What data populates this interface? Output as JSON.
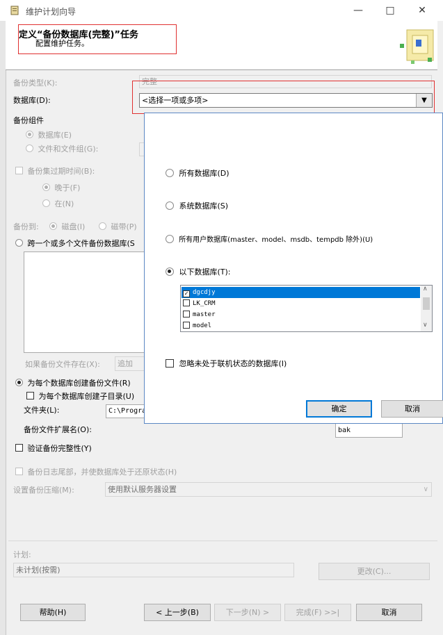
{
  "window": {
    "title": "维护计划向导"
  },
  "header": {
    "title": "定义“备份数据库(完整)”任务",
    "subtitle": "配置维护任务。"
  },
  "form": {
    "backup_type_label": "备份类型(K):",
    "backup_type_value": "完整",
    "database_label": "数据库(D):",
    "database_value": "<选择一项或多项>",
    "backup_component_label": "备份组件",
    "radio_database": "数据库(E)",
    "radio_files": "文件和文件组(G):",
    "expire_label": "备份集过期时间(B):",
    "radio_after": "晚于(F)",
    "radio_on": "在(N)",
    "backup_to_label": "备份到:",
    "radio_disk": "磁盘(I)",
    "radio_tape": "磁带(P)",
    "radio_span": "跨一个或多个文件备份数据库(S",
    "if_exists_label": "如果备份文件存在(X):",
    "if_exists_value": "追加",
    "radio_each_db": "为每个数据库创建备份文件(R)",
    "chk_subdir": "为每个数据库创建子目录(U)",
    "folder_label": "文件夹(L):",
    "folder_value": "C:\\Progra",
    "ext_label": "备份文件扩展名(O):",
    "ext_value": "bak",
    "chk_verify": "验证备份完整性(Y)",
    "chk_tail": "备份日志尾部，并使数据库处于还原状态(H)",
    "compression_label": "设置备份压缩(M):",
    "compression_value": "使用默认服务器设置",
    "schedule_label": "计划:",
    "schedule_value": "未计划(按需)",
    "change_button": "更改(C)..."
  },
  "popup": {
    "opt_all": "所有数据库(D)",
    "opt_system": "系统数据库(S)",
    "opt_user": "所有用户数据库(master、model、msdb、tempdb 除外)(U)",
    "opt_these": "以下数据库(T):",
    "databases": [
      {
        "name": "dgcdjy",
        "checked": true
      },
      {
        "name": "LK_CRM",
        "checked": false
      },
      {
        "name": "master",
        "checked": false
      },
      {
        "name": "model",
        "checked": false
      }
    ],
    "ignore_offline": "忽略未处于联机状态的数据库(I)",
    "ok_button": "确定",
    "cancel_button": "取消"
  },
  "footer": {
    "help_button": "帮助(H)",
    "back_button": "< 上一步(B)",
    "next_button": "下一步(N) >",
    "finish_button": "完成(F) >>|",
    "cancel_button": "取消"
  },
  "colors": {
    "accent": "#0078d7",
    "highlight_border": "#e03030"
  }
}
